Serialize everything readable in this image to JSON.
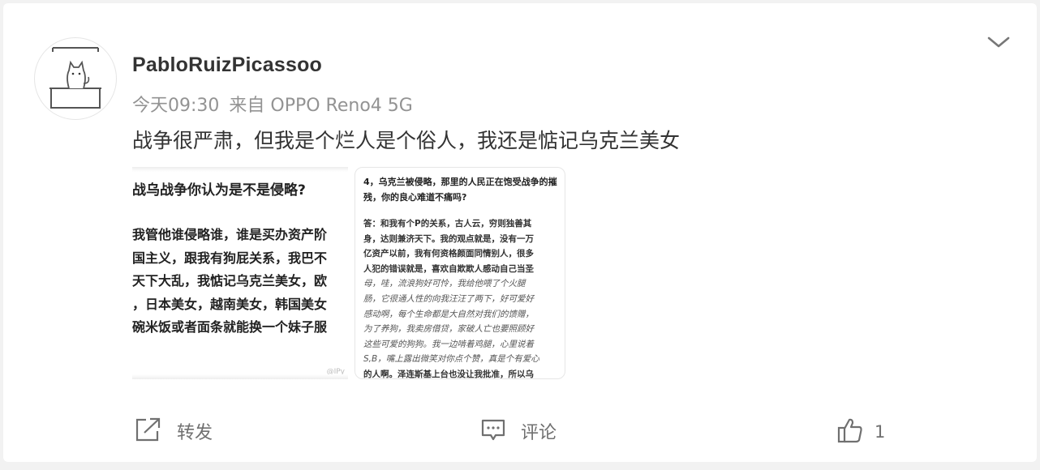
{
  "post": {
    "username": "PabloRuizPicassoo",
    "time": "今天09:30",
    "source": "来自 OPPO Reno4 5G",
    "text": "战争很严肃，但我是个烂人是个俗人，我还是惦记乌克兰美女"
  },
  "image1": {
    "question": "战乌战争你认为是不是侵略?",
    "answer_lines": [
      "我管他谁侵略谁，谁是买办资产阶",
      "国主义，跟我有狗屁关系，我巴不",
      "天下大乱，我惦记乌克兰美女，欧",
      "，日本美女，越南美女，韩国美女",
      "碗米饭或者面条就能换一个妹子服"
    ],
    "watermark": "@IPy"
  },
  "image2": {
    "question": "4，乌克兰被侵略，那里的人民正在饱受战争的摧残，你的良心难道不痛吗?",
    "answer_lines": [
      {
        "text": "答：和我有个P的关系，古人云，穷则独善其",
        "style": "b"
      },
      {
        "text": "身，达则兼济天下。我的观点就是，没有一万",
        "style": "b"
      },
      {
        "text": "亿资产以前，我有何资格颜面同情别人，很多",
        "style": "b"
      },
      {
        "text": "人犯的错误就是，喜欢自欺欺人感动自己当圣",
        "style": "b"
      },
      {
        "text": "母，哇，流浪狗好可怜，我给他喂了个火腿",
        "style": "it"
      },
      {
        "text": "肠，它很通人性的向我汪汪了两下，好可爱好",
        "style": "it"
      },
      {
        "text": "感动啊，每个生命都是大自然对我们的馈赠，",
        "style": "it"
      },
      {
        "text": "为了养狗，我卖房借贷，家破人亡也要照顾好",
        "style": "it"
      },
      {
        "text": "这些可爱的狗狗。我一边啃着鸡腿，心里说着",
        "style": "it"
      },
      {
        "text": "S,B，嘴上露出微笑对你点个赞，真是个有爱心",
        "style": "it"
      },
      {
        "text": "的人啊。泽连斯基上台也没让我批准，所以乌",
        "style": "it"
      }
    ]
  },
  "actions": {
    "share": "转发",
    "comment": "评论",
    "like_count": "1"
  },
  "icons": {
    "menu": "chevron-down-icon",
    "share": "share-icon",
    "comment": "comment-icon",
    "like": "thumbs-up-icon"
  },
  "colors": {
    "text_primary": "#333333",
    "text_secondary": "#939393",
    "icon_gray": "#707070",
    "background": "#f2f2f2"
  }
}
